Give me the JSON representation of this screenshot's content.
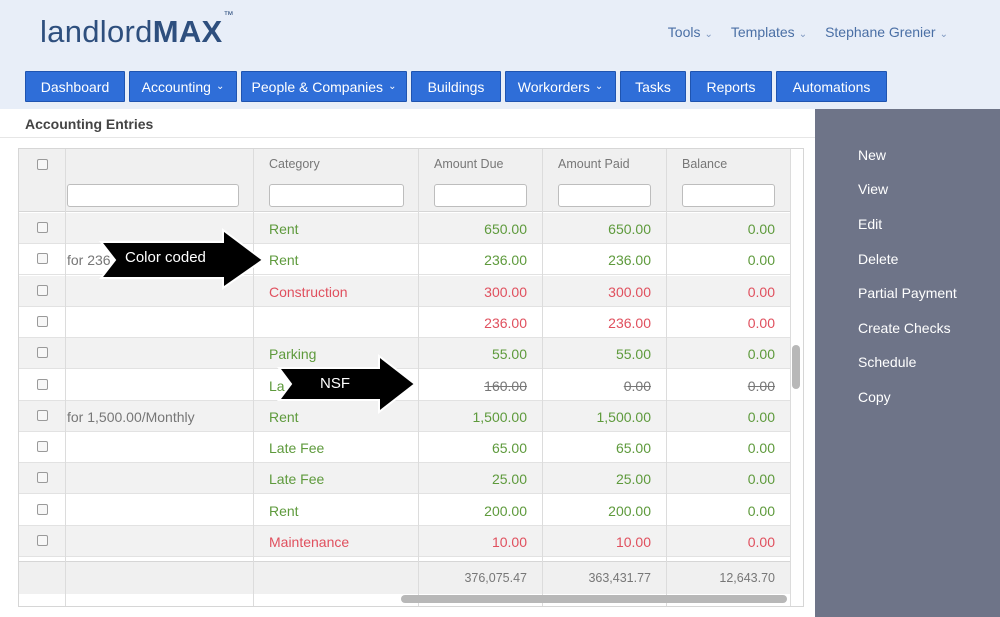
{
  "brand": {
    "logo_light": "landlord",
    "logo_bold": "MAX",
    "logo_tm": "™"
  },
  "top_menu": [
    {
      "label": "Tools"
    },
    {
      "label": "Templates"
    },
    {
      "label": "Stephane Grenier"
    }
  ],
  "nav": [
    {
      "label": "Dashboard",
      "dropdown": false
    },
    {
      "label": "Accounting",
      "dropdown": true
    },
    {
      "label": "People & Companies",
      "dropdown": true
    },
    {
      "label": "Buildings",
      "dropdown": false
    },
    {
      "label": "Workorders",
      "dropdown": true
    },
    {
      "label": "Tasks",
      "dropdown": false
    },
    {
      "label": "Reports",
      "dropdown": false
    },
    {
      "label": "Automations",
      "dropdown": false
    }
  ],
  "page_title": "Accounting Entries",
  "columns": {
    "category": "Category",
    "amount_due": "Amount Due",
    "amount_paid": "Amount Paid",
    "balance": "Balance"
  },
  "rows": [
    {
      "description": "",
      "category": "Rent",
      "amount_due": "650.00",
      "amount_paid": "650.00",
      "balance": "0.00",
      "status": "green"
    },
    {
      "description": "for 236",
      "category": "Rent",
      "amount_due": "236.00",
      "amount_paid": "236.00",
      "balance": "0.00",
      "status": "green"
    },
    {
      "description": "",
      "category": "Construction",
      "amount_due": "300.00",
      "amount_paid": "300.00",
      "balance": "0.00",
      "status": "red"
    },
    {
      "description": "",
      "category": "",
      "amount_due": "236.00",
      "amount_paid": "236.00",
      "balance": "0.00",
      "status": "red"
    },
    {
      "description": "",
      "category": "Parking",
      "amount_due": "55.00",
      "amount_paid": "55.00",
      "balance": "0.00",
      "status": "green"
    },
    {
      "description": "",
      "category": "La",
      "amount_due": "160.00",
      "amount_paid": "0.00",
      "balance": "0.00",
      "status": "nsf"
    },
    {
      "description": "for 1,500.00/Monthly",
      "category": "Rent",
      "amount_due": "1,500.00",
      "amount_paid": "1,500.00",
      "balance": "0.00",
      "status": "green"
    },
    {
      "description": "",
      "category": "Late Fee",
      "amount_due": "65.00",
      "amount_paid": "65.00",
      "balance": "0.00",
      "status": "green"
    },
    {
      "description": "",
      "category": "Late Fee",
      "amount_due": "25.00",
      "amount_paid": "25.00",
      "balance": "0.00",
      "status": "green"
    },
    {
      "description": "",
      "category": "Rent",
      "amount_due": "200.00",
      "amount_paid": "200.00",
      "balance": "0.00",
      "status": "green"
    },
    {
      "description": "",
      "category": "Maintenance",
      "amount_due": "10.00",
      "amount_paid": "10.00",
      "balance": "0.00",
      "status": "red"
    }
  ],
  "totals": {
    "amount_due": "376,075.47",
    "amount_paid": "363,431.77",
    "balance": "12,643.70"
  },
  "side_actions": [
    {
      "label": "New"
    },
    {
      "label": "View"
    },
    {
      "label": "Edit"
    },
    {
      "label": "Delete"
    },
    {
      "label": "Partial Payment"
    },
    {
      "label": "Create Checks"
    },
    {
      "label": "Schedule"
    },
    {
      "label": "Copy"
    }
  ],
  "callouts": {
    "color_coded": "Color coded",
    "nsf": "NSF"
  },
  "colors": {
    "accent": "#2f6ed8",
    "header_bg": "#e8eef8",
    "side_panel": "#6e7488",
    "paid_green": "#5e9a3c",
    "expense_red": "#e0505e"
  }
}
